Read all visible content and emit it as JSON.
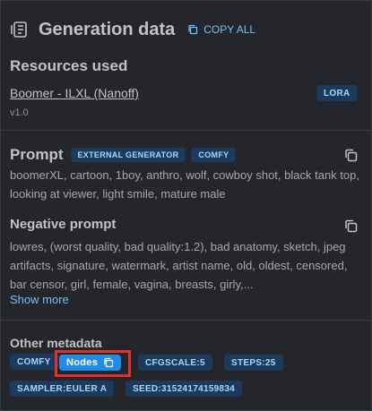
{
  "header": {
    "title": "Generation data",
    "copy_all_label": "COPY ALL"
  },
  "resources": {
    "title": "Resources used",
    "items": [
      {
        "name": "Boomer - ILXL (Nanoff)",
        "version": "v1.0",
        "type": "LORA"
      }
    ]
  },
  "prompt": {
    "title": "Prompt",
    "badges": [
      "EXTERNAL GENERATOR",
      "COMFY"
    ],
    "text": "boomerXL, cartoon, 1boy, anthro, wolf, cowboy shot, black tank top, looking at viewer, light smile, mature male"
  },
  "negative_prompt": {
    "title": "Negative prompt",
    "text": "lowres, (worst quality, bad quality:1.2), bad anatomy, sketch, jpeg artifacts, signature, watermark, artist name, old, oldest, censored, bar censor, girl, female, vagina, breasts, girly,...",
    "show_more_label": "Show more"
  },
  "other_metadata": {
    "title": "Other metadata",
    "chips": {
      "comfy": "COMFY",
      "nodes": "Nodes",
      "cfgscale": "CFGSCALE:5",
      "steps": "STEPS:25",
      "sampler": "SAMPLER:EULER A",
      "seed": "SEED:31524174159834"
    }
  },
  "colors": {
    "background": "#25262b",
    "accent": "#74c0fc",
    "badge_bg": "#1c3a5c",
    "nodes_button": "#228be6",
    "highlight": "#e03131"
  },
  "icons": [
    "generation-data-icon",
    "copy-icon"
  ]
}
